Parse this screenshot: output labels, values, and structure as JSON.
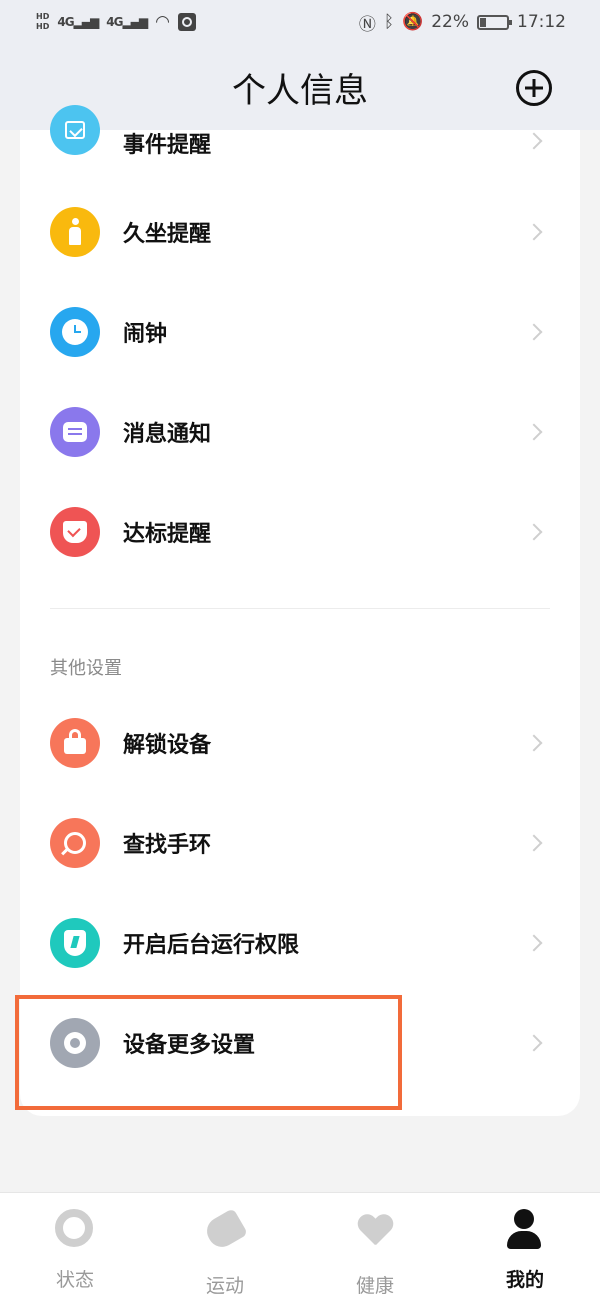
{
  "status_bar": {
    "hd1": "HD",
    "hd2": "HD",
    "net1": "4G",
    "net2": "4G",
    "battery_percent": "22%",
    "time": "17:12",
    "battery_level": 0.22
  },
  "header": {
    "title": "个人信息",
    "add_icon": "plus-circle-icon"
  },
  "reminders": [
    {
      "label": "事件提醒",
      "icon": "calendar-check-icon",
      "color": "#4cc4f0"
    },
    {
      "label": "久坐提醒",
      "icon": "person-standing-icon",
      "color": "#f9b90e"
    },
    {
      "label": "闹钟",
      "icon": "alarm-clock-icon",
      "color": "#27a7ef"
    },
    {
      "label": "消息通知",
      "icon": "message-icon",
      "color": "#8a78ec"
    },
    {
      "label": "达标提醒",
      "icon": "goal-badge-icon",
      "color": "#ef5454"
    }
  ],
  "other_settings": {
    "section_title": "其他设置",
    "items": [
      {
        "label": "解锁设备",
        "icon": "lock-icon",
        "color": "#f7765a"
      },
      {
        "label": "查找手环",
        "icon": "search-icon",
        "color": "#f7765a"
      },
      {
        "label": "开启后台运行权限",
        "icon": "shield-icon",
        "color": "#1fc9bd"
      },
      {
        "label": "设备更多设置",
        "icon": "settings-hex-icon",
        "color": "#a1a7b2"
      }
    ]
  },
  "bottom_nav": [
    {
      "label": "状态",
      "icon": "status-icon",
      "active": false
    },
    {
      "label": "运动",
      "icon": "shoe-icon",
      "active": false
    },
    {
      "label": "健康",
      "icon": "heart-icon",
      "active": false
    },
    {
      "label": "我的",
      "icon": "person-icon",
      "active": true
    }
  ],
  "highlight_color": "#f26b3a"
}
